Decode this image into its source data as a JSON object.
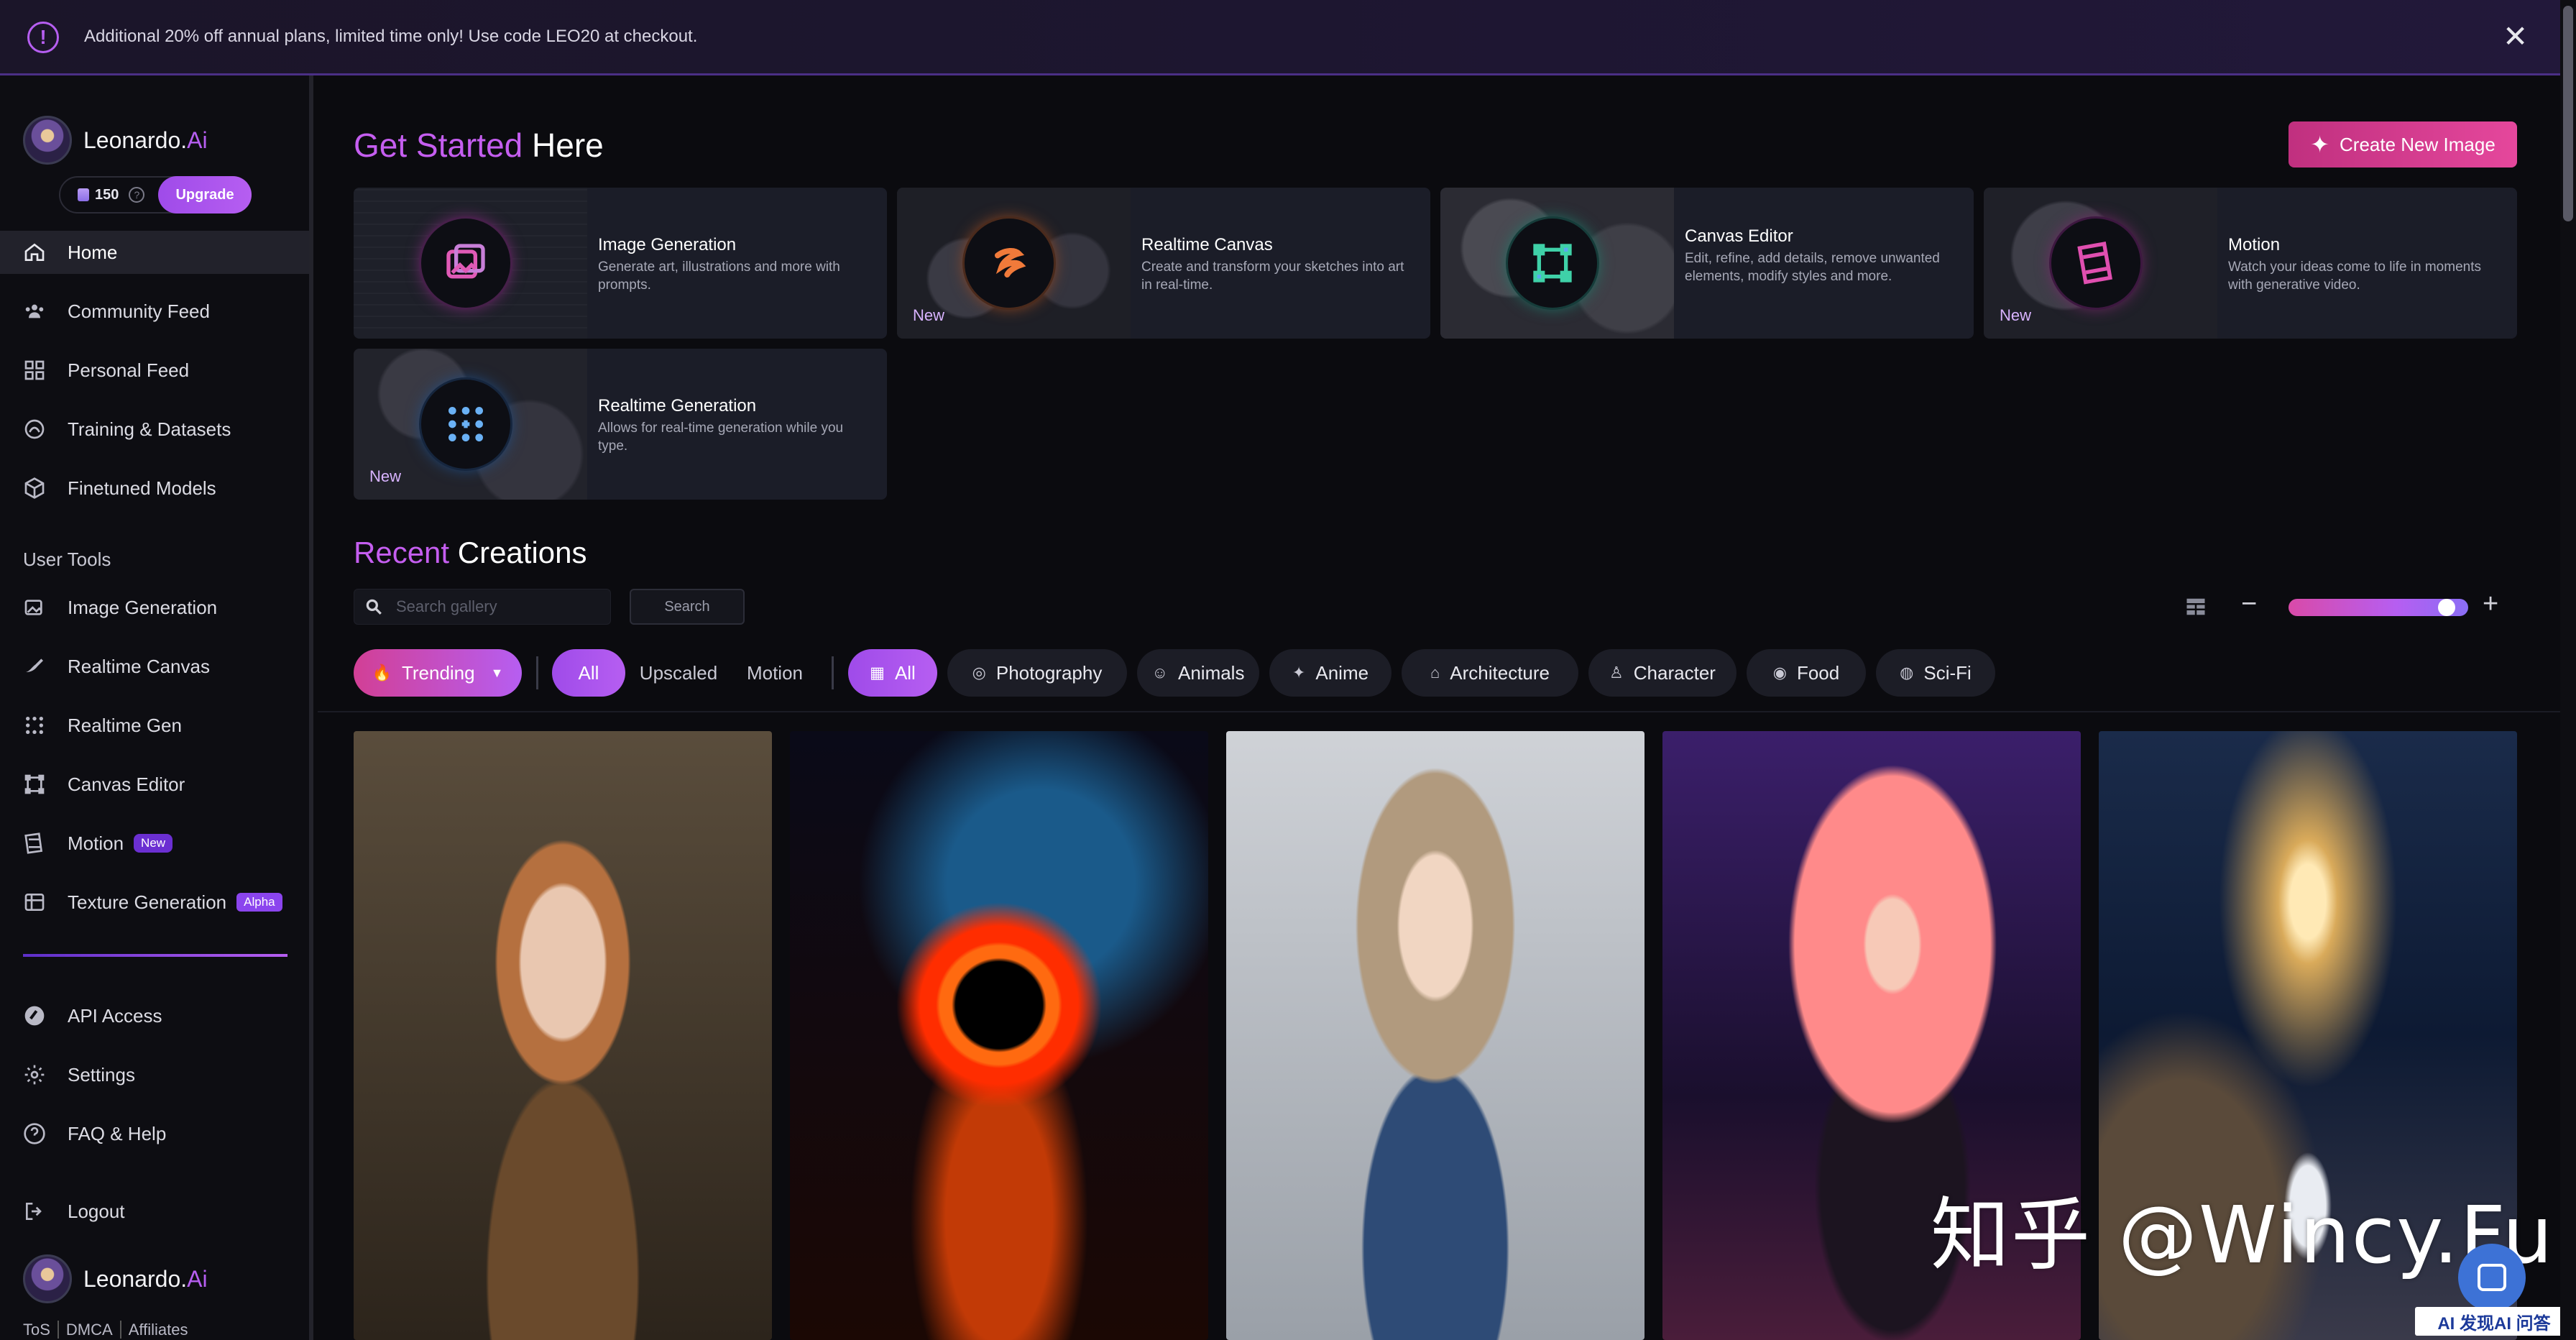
{
  "banner": {
    "message": "Additional 20% off annual plans, limited time only! Use code LEO20 at checkout.",
    "close_symbol": "✕"
  },
  "brand": {
    "name": "Leonardo.",
    "suffix": "Ai"
  },
  "credits": {
    "amount": "150",
    "help_symbol": "?",
    "upgrade_label": "Upgrade"
  },
  "sidebar": {
    "main_nav": [
      {
        "label": "Home",
        "icon": "home-icon"
      },
      {
        "label": "Community Feed",
        "icon": "community-icon"
      },
      {
        "label": "Personal Feed",
        "icon": "grid-icon"
      },
      {
        "label": "Training & Datasets",
        "icon": "training-icon"
      },
      {
        "label": "Finetuned Models",
        "icon": "cube-icon"
      }
    ],
    "user_tools_label": "User Tools",
    "tools": [
      {
        "label": "Image Generation",
        "icon": "image-gen-icon"
      },
      {
        "label": "Realtime Canvas",
        "icon": "brush-icon"
      },
      {
        "label": "Realtime Gen",
        "icon": "dots-grid-icon"
      },
      {
        "label": "Canvas Editor",
        "icon": "frame-icon"
      },
      {
        "label": "Motion",
        "icon": "film-icon",
        "badge": "New"
      },
      {
        "label": "Texture Generation",
        "icon": "texture-icon",
        "badge": "Alpha"
      }
    ],
    "bottom": [
      {
        "label": "API Access",
        "icon": "api-icon"
      },
      {
        "label": "Settings",
        "icon": "gear-icon"
      },
      {
        "label": "FAQ & Help",
        "icon": "help-icon"
      }
    ],
    "logout": "Logout",
    "footer_links": [
      "ToS",
      "DMCA",
      "Affiliates"
    ]
  },
  "main": {
    "get_started": {
      "accent": "Get Started",
      "rest": " Here"
    },
    "create_button": "Create New Image",
    "tool_cards": [
      {
        "title": "Image Generation",
        "desc": "Generate art, illustrations and more with prompts.",
        "new": ""
      },
      {
        "title": "Realtime Canvas",
        "desc": "Create and transform your sketches into art in real-time.",
        "new": "New"
      },
      {
        "title": "Canvas Editor",
        "desc": "Edit, refine, add details, remove unwanted elements, modify styles and more.",
        "new": ""
      },
      {
        "title": "Motion",
        "desc": "Watch your ideas come to life in moments with generative video.",
        "new": "New"
      },
      {
        "title": "Realtime Generation",
        "desc": "Allows for real-time generation while you type.",
        "new": "New"
      }
    ],
    "recent": {
      "accent": "Recent",
      "rest": " Creations"
    },
    "search": {
      "placeholder": "Search gallery",
      "button": "Search"
    },
    "view": {
      "minus": "−",
      "plus": "+",
      "zoom_fraction": 0.92
    },
    "filters": {
      "sort": "Trending",
      "types": [
        "All",
        "Upscaled",
        "Motion"
      ],
      "categories": [
        "All",
        "Photography",
        "Animals",
        "Anime",
        "Architecture",
        "Character",
        "Food",
        "Sci-Fi"
      ]
    }
  },
  "watermark": "知乎 @Wincy.Fu",
  "corner_logo": "AI 发现AI 问答"
}
